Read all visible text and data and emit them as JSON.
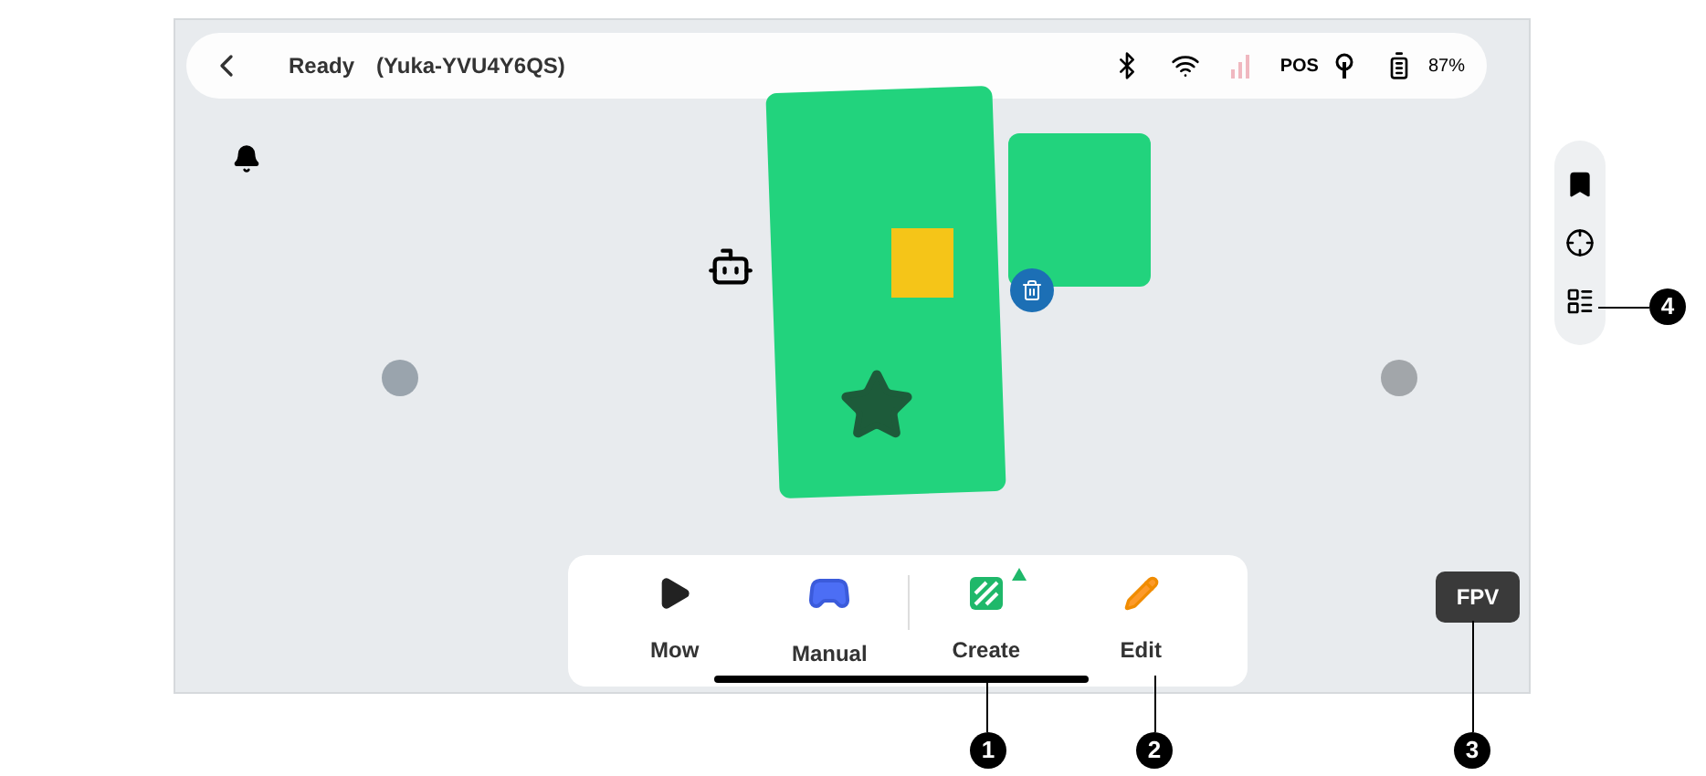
{
  "status_bar": {
    "status": "Ready",
    "device": "(Yuka-YVU4Y6QS)",
    "position_label": "POS",
    "battery": "87%"
  },
  "dock": [
    {
      "kind": "mow",
      "label": "Mow"
    },
    {
      "kind": "manual",
      "label": "Manual"
    },
    {
      "kind": "create",
      "label": "Create"
    },
    {
      "kind": "edit",
      "label": "Edit"
    }
  ],
  "fpv": "FPV",
  "callouts": [
    "1",
    "2",
    "3",
    "4"
  ]
}
